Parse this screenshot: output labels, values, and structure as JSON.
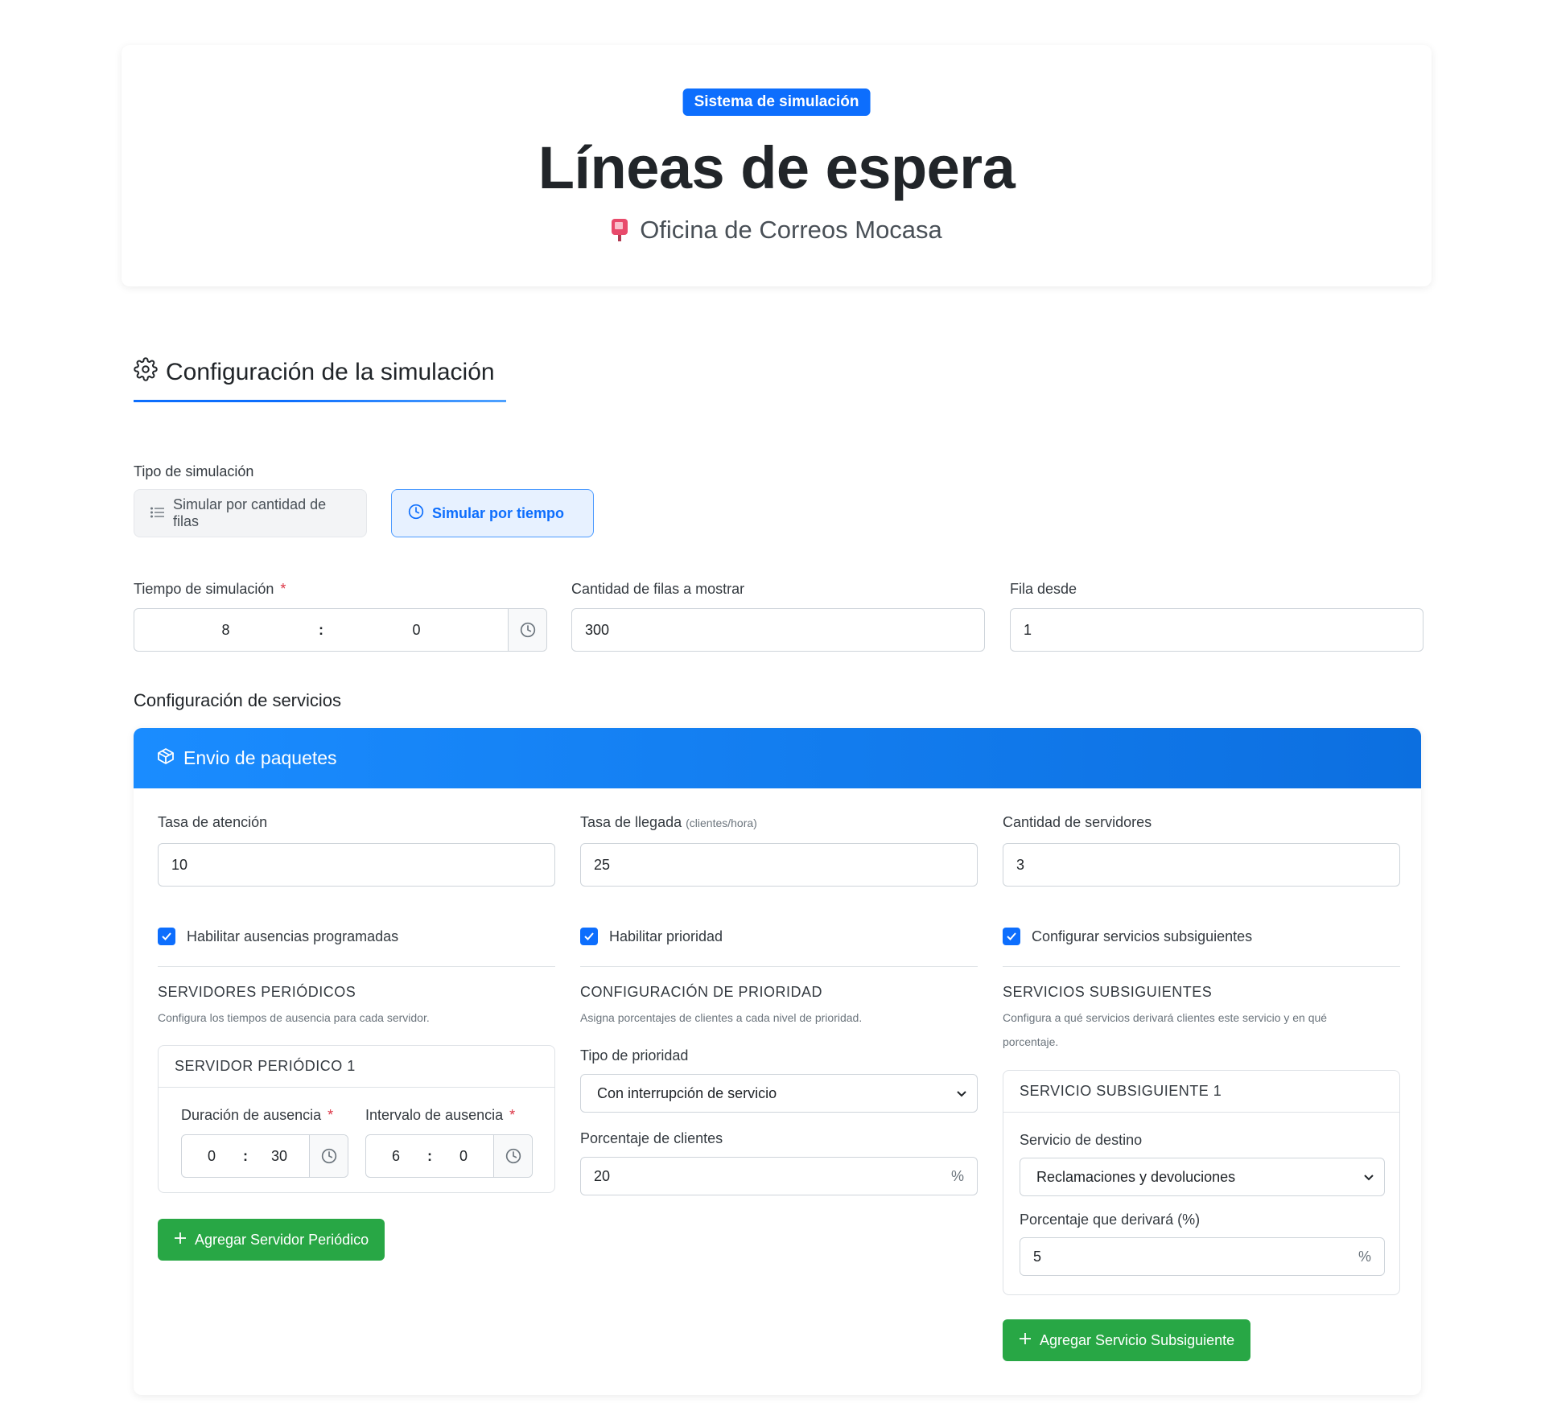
{
  "header": {
    "badge": "Sistema de simulación",
    "title": "Líneas de espera",
    "subtitle": "Oficina de Correos Mocasa"
  },
  "config": {
    "section_title": "Configuración de la simulación",
    "sim_type_label": "Tipo de simulación",
    "sim_type_options": {
      "rows": "Simular por cantidad de filas",
      "time": "Simular por tiempo"
    },
    "selected_sim_type": "time",
    "sim_time_label": "Tiempo de simulación",
    "sim_time": {
      "hours": "8",
      "minutes": "0"
    },
    "rows_to_show_label": "Cantidad de filas a mostrar",
    "rows_to_show": "300",
    "row_from_label": "Fila desde",
    "row_from": "1",
    "required_mark": "*"
  },
  "services_heading": "Configuración de servicios",
  "service": {
    "name": "Envio de paquetes",
    "attention_rate_label": "Tasa de atención",
    "attention_rate": "10",
    "arrival_rate_label": "Tasa de llegada",
    "arrival_rate_unit": "(clientes/hora)",
    "arrival_rate": "25",
    "servers_label": "Cantidad de servidores",
    "servers": "3",
    "absences": {
      "checkbox_label": "Habilitar ausencias programadas",
      "checked": true,
      "title": "SERVIDORES PERIÓDICOS",
      "description": "Configura los tiempos de ausencia para cada servidor.",
      "server_title": "SERVIDOR PERIÓDICO 1",
      "duration_label": "Duración de ausencia",
      "duration": {
        "hours": "0",
        "minutes": "30"
      },
      "interval_label": "Intervalo de ausencia",
      "interval": {
        "hours": "6",
        "minutes": "0"
      },
      "add_button": "Agregar Servidor Periódico"
    },
    "priority": {
      "checkbox_label": "Habilitar prioridad",
      "checked": true,
      "title": "CONFIGURACIÓN DE PRIORIDAD",
      "description": "Asigna porcentajes de clientes a cada nivel de prioridad.",
      "type_label": "Tipo de prioridad",
      "type_value": "Con interrupción de servicio",
      "percent_label": "Porcentaje de clientes",
      "percent_value": "20",
      "percent_symbol": "%"
    },
    "subsequent": {
      "checkbox_label": "Configurar servicios subsiguientes",
      "checked": true,
      "title": "SERVICIOS SUBSIGUIENTES",
      "description_line1": "Configura a qué servicios derivará clientes este servicio y en qué",
      "description_line2": "porcentaje.",
      "item_title": "SERVICIO SUBSIGUIENTE 1",
      "target_label": "Servicio de destino",
      "target_value": "Reclamaciones y devoluciones",
      "percent_label": "Porcentaje que derivará (%)",
      "percent_value": "5",
      "percent_symbol": "%",
      "add_button": "Agregar Servicio Subsiguiente"
    }
  },
  "colors": {
    "primary": "#0d6efd",
    "success": "#28a745",
    "danger": "#dc3545"
  }
}
